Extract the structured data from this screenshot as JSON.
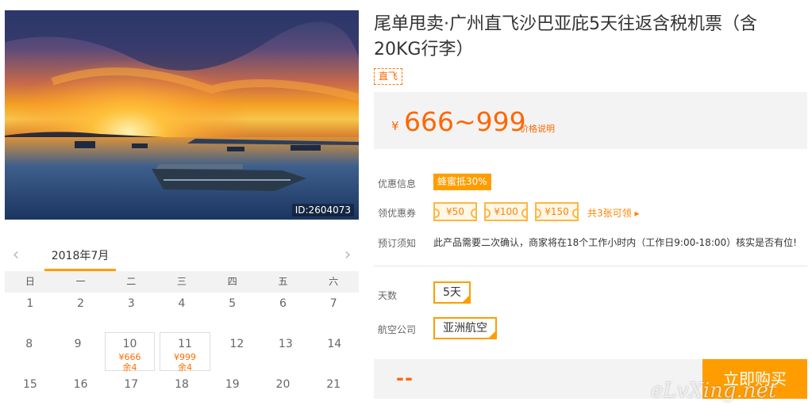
{
  "photo": {
    "id_label": "ID:2604073"
  },
  "calendar": {
    "month": "2018年7月",
    "prev_icon": "chevron-left-icon",
    "next_icon": "chevron-right-icon",
    "weekdays": [
      "日",
      "一",
      "二",
      "三",
      "四",
      "五",
      "六"
    ],
    "rows": [
      [
        {
          "d": "1"
        },
        {
          "d": "2"
        },
        {
          "d": "3"
        },
        {
          "d": "4"
        },
        {
          "d": "5"
        },
        {
          "d": "6"
        },
        {
          "d": "7"
        }
      ],
      [
        {
          "d": "8"
        },
        {
          "d": "9"
        },
        {
          "d": "10",
          "price": "¥666",
          "stock": "余4"
        },
        {
          "d": "11",
          "price": "¥999",
          "stock": "余4"
        },
        {
          "d": "12"
        },
        {
          "d": "13"
        },
        {
          "d": "14"
        }
      ],
      [
        {
          "d": "15"
        },
        {
          "d": "16"
        },
        {
          "d": "17"
        },
        {
          "d": "18"
        },
        {
          "d": "19"
        },
        {
          "d": "20"
        },
        {
          "d": "21"
        }
      ]
    ]
  },
  "product": {
    "title": "尾单甩卖·广州直飞沙巴亚庇5天往返含税机票（含20KG行李）",
    "tag": "直飞",
    "yen": "¥",
    "price_range": "666~999",
    "price_explain": "价格说明"
  },
  "promo": {
    "label": "优惠信息",
    "value": "蜂蜜抵30%"
  },
  "coupons": {
    "label": "领优惠券",
    "items": [
      "¥50",
      "¥100",
      "¥150"
    ],
    "more": "共3张可领 ▸"
  },
  "notice": {
    "label": "预订须知",
    "text": "此产品需要二次确认，商家将在18个工作小时内（工作日9:00-18:00）核实是否有位!"
  },
  "options": {
    "days_label": "天数",
    "days_value": "5天",
    "airline_label": "航空公司",
    "airline_value": "亚洲航空"
  },
  "buy": {
    "price_placeholder": "--",
    "button": "立即购买"
  },
  "watermark": "eLvXing.net",
  "colors": {
    "accent": "#ff9d00",
    "price": "#ff6600"
  }
}
